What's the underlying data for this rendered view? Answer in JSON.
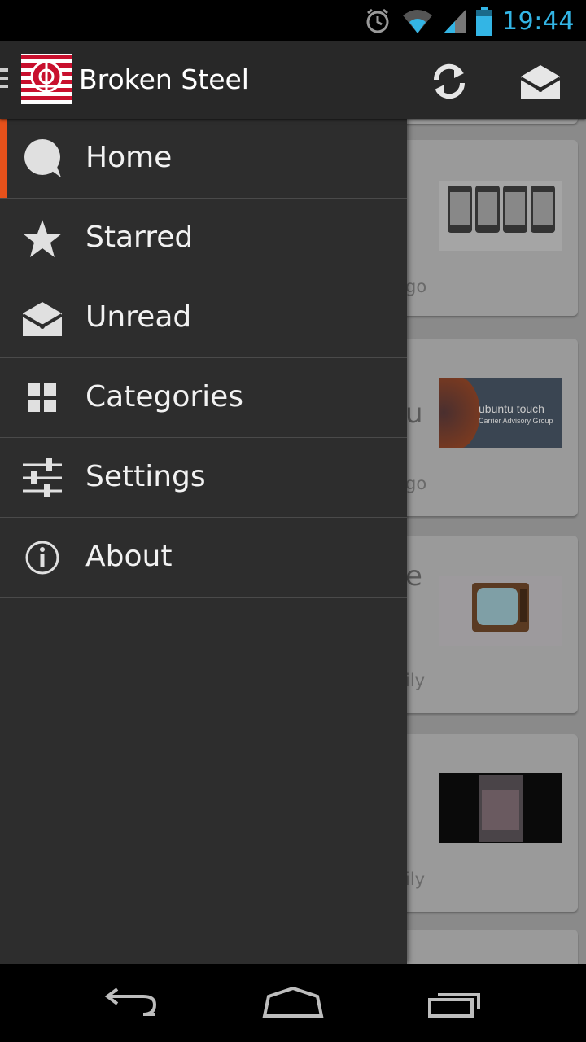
{
  "status_bar": {
    "time": "19:44",
    "icons": [
      "alarm-icon",
      "wifi-icon",
      "signal-icon",
      "battery-icon"
    ]
  },
  "action_bar": {
    "title": "Broken Steel",
    "actions": [
      "refresh-icon",
      "unread-mail-icon"
    ]
  },
  "drawer": {
    "items": [
      {
        "label": "Home",
        "icon": "chat-bubble-icon",
        "active": true
      },
      {
        "label": "Starred",
        "icon": "star-icon",
        "active": false
      },
      {
        "label": "Unread",
        "icon": "open-envelope-icon",
        "active": false
      },
      {
        "label": "Categories",
        "icon": "grid-icon",
        "active": false
      },
      {
        "label": "Settings",
        "icon": "sliders-icon",
        "active": false
      },
      {
        "label": "About",
        "icon": "info-icon",
        "active": false
      }
    ]
  },
  "background_feed": {
    "fragments": [
      "go",
      "u",
      "go",
      "e",
      "ily",
      "ily"
    ],
    "thumb_texts": {
      "ubuntu_title": "ubuntu touch",
      "ubuntu_sub": "Carrier Advisory Group"
    }
  },
  "colors": {
    "accent": "#e6511b",
    "time": "#33b5e5",
    "drawer_bg": "#2d2d2d",
    "actionbar_bg": "#282828"
  },
  "nav_bar": {
    "buttons": [
      "back-icon",
      "home-icon",
      "recent-apps-icon"
    ]
  }
}
